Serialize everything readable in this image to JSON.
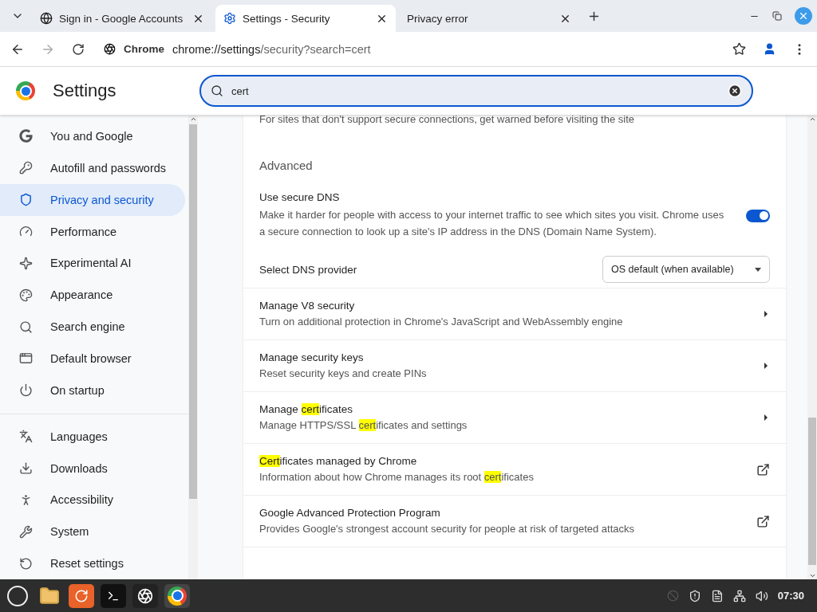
{
  "tabs": [
    {
      "title": "Sign in - Google Accounts",
      "selected": false
    },
    {
      "title": "Settings - Security",
      "selected": true
    },
    {
      "title": "Privacy error",
      "selected": false
    }
  ],
  "address": {
    "chip": "Chrome",
    "url_host": "chrome://settings",
    "url_path": "/security?search=cert"
  },
  "header": {
    "title": "Settings",
    "search_value": "cert"
  },
  "sidebar": {
    "groups": [
      [
        {
          "label": "You and Google",
          "selected": false
        },
        {
          "label": "Autofill and passwords",
          "selected": false
        },
        {
          "label": "Privacy and security",
          "selected": true
        },
        {
          "label": "Performance",
          "selected": false
        },
        {
          "label": "Experimental AI",
          "selected": false
        },
        {
          "label": "Appearance",
          "selected": false
        },
        {
          "label": "Search engine",
          "selected": false
        },
        {
          "label": "Default browser",
          "selected": false
        },
        {
          "label": "On startup",
          "selected": false
        }
      ],
      [
        {
          "label": "Languages",
          "selected": false
        },
        {
          "label": "Downloads",
          "selected": false
        },
        {
          "label": "Accessibility",
          "selected": false
        },
        {
          "label": "System",
          "selected": false
        },
        {
          "label": "Reset settings",
          "selected": false
        }
      ]
    ]
  },
  "content": {
    "partial_text": "For sites that don't support secure connections, get warned before visiting the site",
    "section_title": "Advanced",
    "secure_dns": {
      "label": "Use secure DNS",
      "description": "Make it harder for people with access to your internet traffic to see which sites you visit. Chrome uses a secure connection to look up a site's IP address in the DNS (Domain Name System).",
      "on": true
    },
    "dns_provider": {
      "label": "Select DNS provider",
      "value": "OS default (when available)"
    },
    "rows": [
      {
        "kind": "arrow",
        "title": [
          {
            "text": "Manage V8 security",
            "highlight": false
          }
        ],
        "description": [
          {
            "text": "Turn on additional protection in Chrome's JavaScript and WebAssembly engine",
            "highlight": false
          }
        ]
      },
      {
        "kind": "arrow",
        "title": [
          {
            "text": "Manage security keys",
            "highlight": false
          }
        ],
        "description": [
          {
            "text": "Reset security keys and create PINs",
            "highlight": false
          }
        ]
      },
      {
        "kind": "arrow",
        "title": [
          {
            "text": "Manage ",
            "highlight": false
          },
          {
            "text": "cert",
            "highlight": true
          },
          {
            "text": "ificates",
            "highlight": false
          }
        ],
        "description": [
          {
            "text": "Manage HTTPS/SSL ",
            "highlight": false
          },
          {
            "text": "cert",
            "highlight": true
          },
          {
            "text": "ificates and settings",
            "highlight": false
          }
        ]
      },
      {
        "kind": "external",
        "title": [
          {
            "text": "Cert",
            "highlight": true
          },
          {
            "text": "ificates managed by Chrome",
            "highlight": false
          }
        ],
        "description": [
          {
            "text": "Information about how Chrome manages its root ",
            "highlight": false
          },
          {
            "text": "cert",
            "highlight": true
          },
          {
            "text": "ificates",
            "highlight": false
          }
        ]
      },
      {
        "kind": "external",
        "title": [
          {
            "text": "Google Advanced Protection Program",
            "highlight": false
          }
        ],
        "description": [
          {
            "text": "Provides Google's strongest account security for people at risk of targeted attacks",
            "highlight": false
          }
        ]
      }
    ]
  },
  "taskbar": {
    "clock": "07:30"
  }
}
